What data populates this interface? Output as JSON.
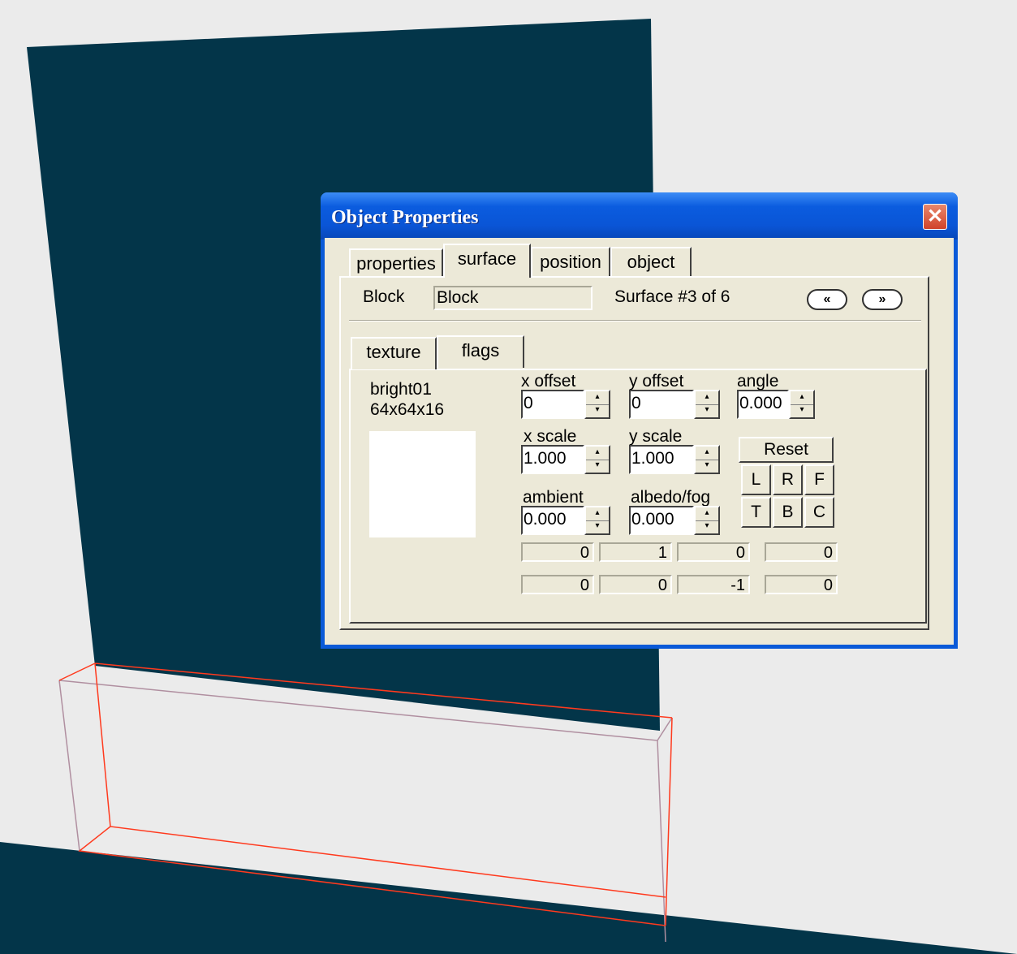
{
  "window": {
    "title": "Object Properties",
    "close": "✕"
  },
  "tabs": [
    "properties",
    "surface",
    "position",
    "object"
  ],
  "header": {
    "block_label": "Block",
    "block_value": "Block",
    "surface_info": "Surface #3 of 6",
    "prev": "«",
    "next": "»"
  },
  "subtabs": [
    "texture",
    "flags"
  ],
  "texture": {
    "name": "bright01",
    "dims": "64x64x16"
  },
  "fields": {
    "x_offset": {
      "label": "x offset",
      "value": "0"
    },
    "y_offset": {
      "label": "y offset",
      "value": "0"
    },
    "angle": {
      "label": "angle",
      "value": "0.000"
    },
    "x_scale": {
      "label": "x scale",
      "value": "1.000"
    },
    "y_scale": {
      "label": "y scale",
      "value": "1.000"
    },
    "ambient": {
      "label": "ambient",
      "value": "0.000"
    },
    "albedo": {
      "label": "albedo/fog",
      "value": "0.000"
    }
  },
  "buttons": {
    "reset": "Reset",
    "L": "L",
    "R": "R",
    "F": "F",
    "T": "T",
    "B": "B",
    "C": "C"
  },
  "vectors": [
    [
      "0",
      "1",
      "0",
      "0"
    ],
    [
      "0",
      "0",
      "-1",
      "0"
    ]
  ],
  "colors": {
    "wall": "#033549",
    "edge_selected": "#ff3a1e",
    "edge_hidden": "#b08fa0"
  }
}
